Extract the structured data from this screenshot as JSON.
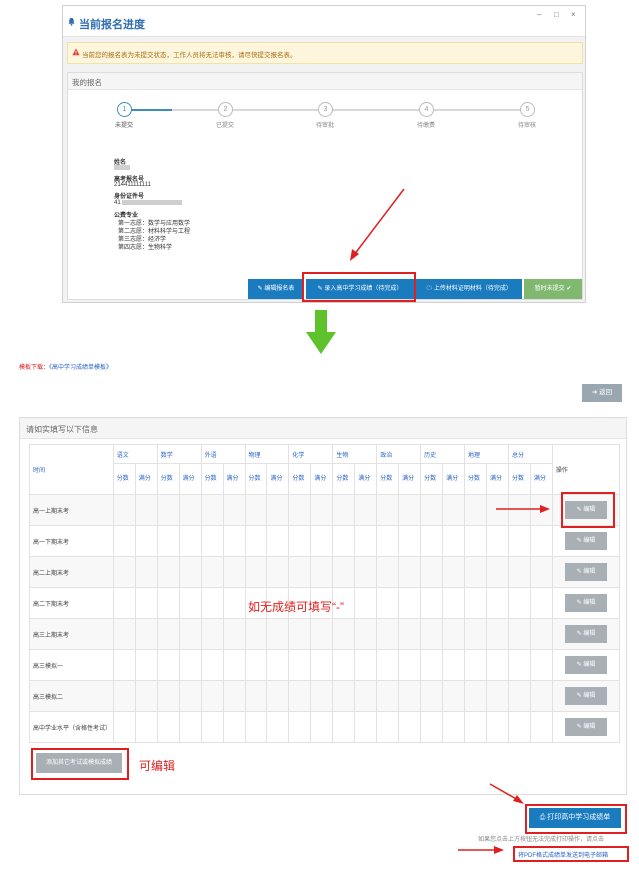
{
  "window": {
    "title": "当前报名进度",
    "controls": [
      "–",
      "□",
      "×"
    ],
    "notice": "当前您的报名表为未提交状态，工作人员将无法审核，请尽快提交报名表。"
  },
  "my_signup": {
    "header": "我的报名",
    "steps": [
      {
        "num": "1",
        "label": "未提交"
      },
      {
        "num": "2",
        "label": "已提交"
      },
      {
        "num": "3",
        "label": "待审批"
      },
      {
        "num": "4",
        "label": "待缴费"
      },
      {
        "num": "5",
        "label": "待审核"
      }
    ],
    "info": {
      "name_label": "姓名",
      "exam_no_label": "高考报名号",
      "exam_no_value": "214411111111",
      "id_label": "身份证件号",
      "id_prefix": "41",
      "major_label": "公费专业",
      "majors": [
        "第一志愿：数学与应用数学",
        "第二志愿：材料科学与工程",
        "第三志愿：经济学",
        "第四志愿：生物科学"
      ]
    },
    "buttons": {
      "edit": "编辑报名表",
      "grades": "录入高中学习成绩（待完成）",
      "upload": "上传材料证明材料（待完成）",
      "submit": "暂时未提交"
    }
  },
  "template": {
    "prefix": "模板下载：",
    "link": "《高中学习成绩单模板》"
  },
  "back_label": "返回",
  "grades_panel": {
    "header": "请如实填写以下信息",
    "time_col": "时间",
    "op_col": "操作",
    "subjects": [
      "语文",
      "数学",
      "外语",
      "物理",
      "化学",
      "生物",
      "政治",
      "历史",
      "地理",
      "总分"
    ],
    "sub_score": "分数",
    "sub_full": "满分",
    "rows": [
      "高一上期末考",
      "高一下期末考",
      "高二上期末考",
      "高二下期末考",
      "高三上期末考",
      "高三模拟一",
      "高三模拟二",
      "高中学业水平（含格性考试）"
    ],
    "edit_label": "编辑",
    "add_label": "添加其它考试或模拟成绩",
    "annotation_fill": "如无成绩可填写“-”",
    "annotation_edit": "可编辑"
  },
  "print_label": "打印高中学习成绩单",
  "hint": "如果您点击上方按钮无法完成打印操作，请点击",
  "hint_link": "将PDF格式成绩单发送到电子邮箱"
}
